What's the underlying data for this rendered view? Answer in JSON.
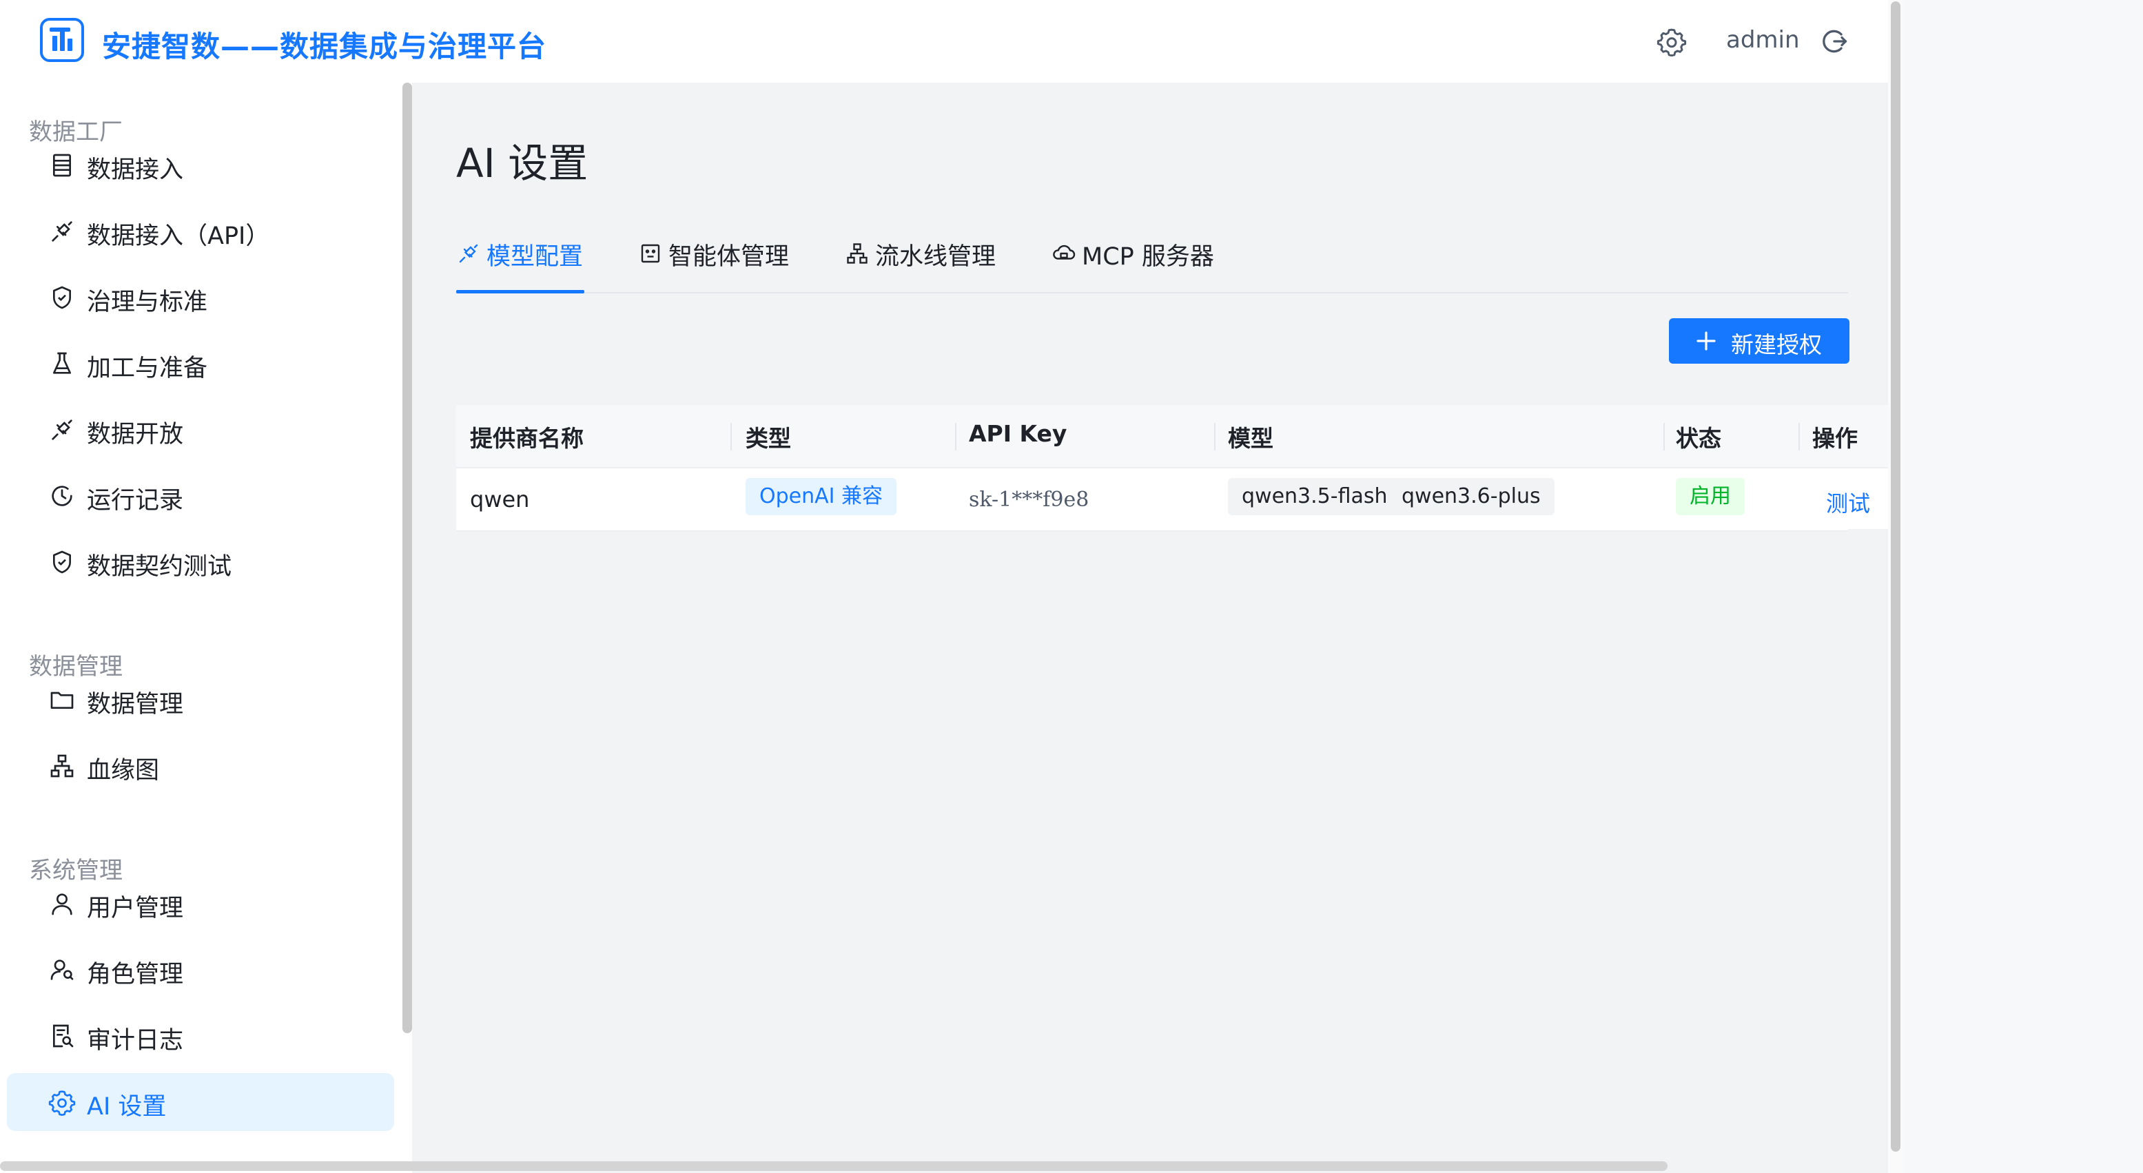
{
  "header": {
    "app_title": "安捷智数——数据集成与治理平台",
    "username": "admin",
    "settings_icon": "gear-icon",
    "logout_icon": "logout-icon"
  },
  "sidebar": {
    "groups": [
      {
        "title": "数据工厂",
        "items": [
          {
            "label": "数据接入",
            "icon": "database-icon"
          },
          {
            "label": "数据接入（API）",
            "icon": "api-plug-icon"
          },
          {
            "label": "治理与标准",
            "icon": "shield-check-icon"
          },
          {
            "label": "加工与准备",
            "icon": "flask-icon"
          },
          {
            "label": "数据开放",
            "icon": "api-plug-icon"
          },
          {
            "label": "运行记录",
            "icon": "clock-icon"
          },
          {
            "label": "数据契约测试",
            "icon": "shield-check-icon"
          }
        ]
      },
      {
        "title": "数据管理",
        "items": [
          {
            "label": "数据管理",
            "icon": "folder-icon"
          },
          {
            "label": "血缘图",
            "icon": "lineage-icon"
          }
        ]
      },
      {
        "title": "系统管理",
        "items": [
          {
            "label": "用户管理",
            "icon": "user-icon"
          },
          {
            "label": "角色管理",
            "icon": "users-icon"
          },
          {
            "label": "审计日志",
            "icon": "audit-icon"
          },
          {
            "label": "AI 设置",
            "icon": "gear-icon",
            "active": true
          }
        ]
      }
    ]
  },
  "main": {
    "page_title": "AI 设置",
    "tabs": [
      {
        "label": "模型配置",
        "icon": "api-plug-icon",
        "active": true
      },
      {
        "label": "智能体管理",
        "icon": "robot-icon"
      },
      {
        "label": "流水线管理",
        "icon": "pipeline-icon"
      },
      {
        "label": "MCP 服务器",
        "icon": "cloud-server-icon"
      }
    ],
    "new_button_label": "新建授权",
    "table": {
      "columns": [
        "提供商名称",
        "类型",
        "API Key",
        "模型",
        "状态",
        "操作"
      ],
      "rows": [
        {
          "provider": "qwen",
          "type": "OpenAI 兼容",
          "api_key": "sk-1***f9e8",
          "models": [
            "qwen3.5-flash",
            "qwen3.6-plus"
          ],
          "status": "启用",
          "action": "测试"
        }
      ]
    }
  },
  "colors": {
    "primary": "#1677ff",
    "active_bg": "#e6f4ff",
    "content_bg": "#f2f3f5",
    "success": "#00b42a"
  }
}
